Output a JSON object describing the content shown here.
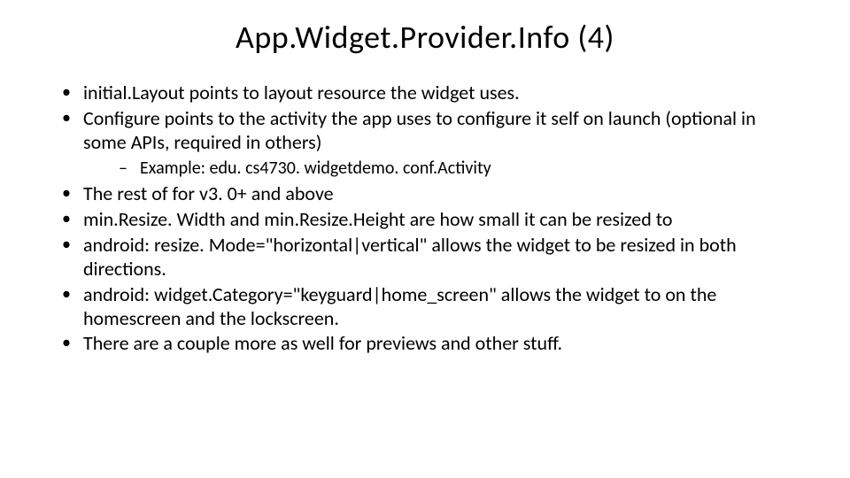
{
  "title": "App.Widget.Provider.Info (4)",
  "bullets": [
    "initial.Layout points to layout resource the widget uses.",
    "Configure points to the activity the app uses to configure it self on launch (optional in some APIs, required in others)"
  ],
  "subbullet": "Example: edu. cs4730. widgetdemo. conf.Activity",
  "bullets2": [
    "The rest of for v3. 0+ and above",
    "min.Resize. Width and min.Resize.Height are how small it can be resized to",
    "android: resize. Mode=\"horizontal|vertical\"  allows the widget to be resized in both directions.",
    "android: widget.Category=\"keyguard|home_screen\" allows the widget to on the homescreen and the lockscreen.",
    "There are a couple more as well for previews and other stuff."
  ]
}
